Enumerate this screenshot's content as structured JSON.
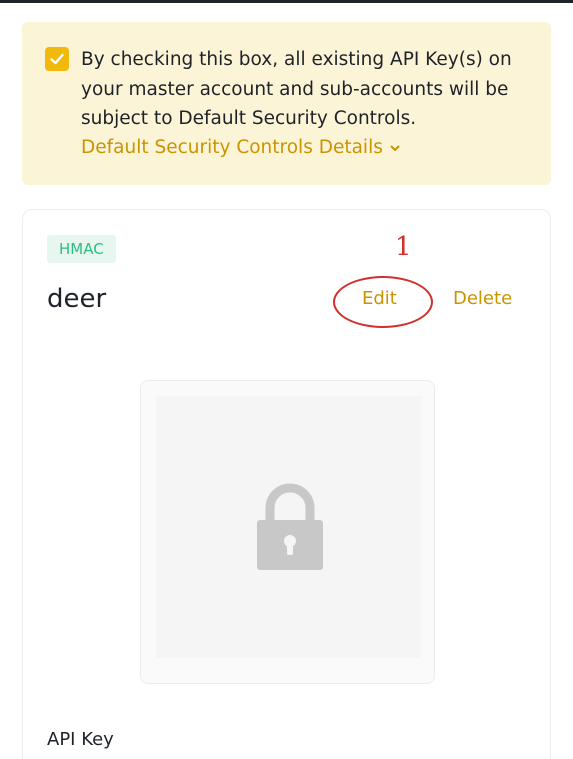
{
  "notice": {
    "checkbox_checked": true,
    "text": "By checking this box, all existing API Key(s) on your master account and sub-accounts will be subject to Default Security Controls.",
    "details_link": "Default Security Controls Details",
    "accent_color": "#f0b90b",
    "link_color": "#c99400"
  },
  "api_key_card": {
    "tag": "HMAC",
    "name": "deer",
    "edit_label": "Edit",
    "delete_label": "Delete",
    "qr_placeholder_icon": "lock-icon",
    "api_key_label": "API Key"
  },
  "annotation": {
    "number": "1",
    "color": "#d0312d"
  }
}
